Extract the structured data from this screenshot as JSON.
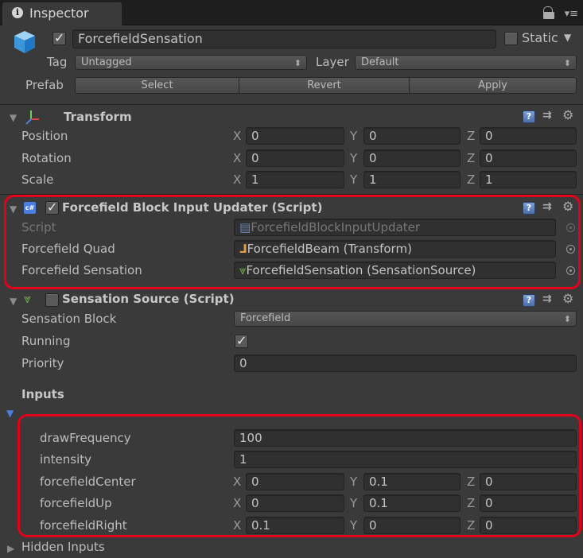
{
  "tab": {
    "title": "Inspector"
  },
  "object": {
    "name": "ForcefieldSensation",
    "static_label": "Static",
    "tag_label": "Tag",
    "tag_value": "Untagged",
    "layer_label": "Layer",
    "layer_value": "Default",
    "prefab_label": "Prefab",
    "select": "Select",
    "revert": "Revert",
    "apply": "Apply"
  },
  "transform": {
    "title": "Transform",
    "rows": [
      {
        "label": "Position",
        "x": "0",
        "y": "0",
        "z": "0"
      },
      {
        "label": "Rotation",
        "x": "0",
        "y": "0",
        "z": "0"
      },
      {
        "label": "Scale",
        "x": "1",
        "y": "1",
        "z": "1"
      }
    ]
  },
  "axes": {
    "x": "X",
    "y": "Y",
    "z": "Z"
  },
  "updater": {
    "title": "Forcefield Block Input Updater (Script)",
    "script_label": "Script",
    "script_value": "ForcefieldBlockInputUpdater",
    "quad_label": "Forcefield Quad",
    "quad_value": "ForcefieldBeam (Transform)",
    "sensation_label": "Forcefield Sensation",
    "sensation_value": "ForcefieldSensation (SensationSource)"
  },
  "source": {
    "title": "Sensation Source (Script)",
    "block_label": "Sensation Block",
    "block_value": "Forcefield",
    "running_label": "Running",
    "priority_label": "Priority",
    "priority_value": "0",
    "inputs_label": "Inputs",
    "draw_label": "drawFrequency",
    "draw_value": "100",
    "intensity_label": "intensity",
    "intensity_value": "1",
    "vectors": [
      {
        "label": "forcefieldCenter",
        "x": "0",
        "y": "0.1",
        "z": "0"
      },
      {
        "label": "forcefieldUp",
        "x": "0",
        "y": "0.1",
        "z": "0"
      },
      {
        "label": "forcefieldRight",
        "x": "0.1",
        "y": "0",
        "z": "0"
      }
    ],
    "hidden_label": "Hidden Inputs"
  },
  "colors": {
    "highlight": "#e3001b",
    "background": "#3a3a3a"
  }
}
